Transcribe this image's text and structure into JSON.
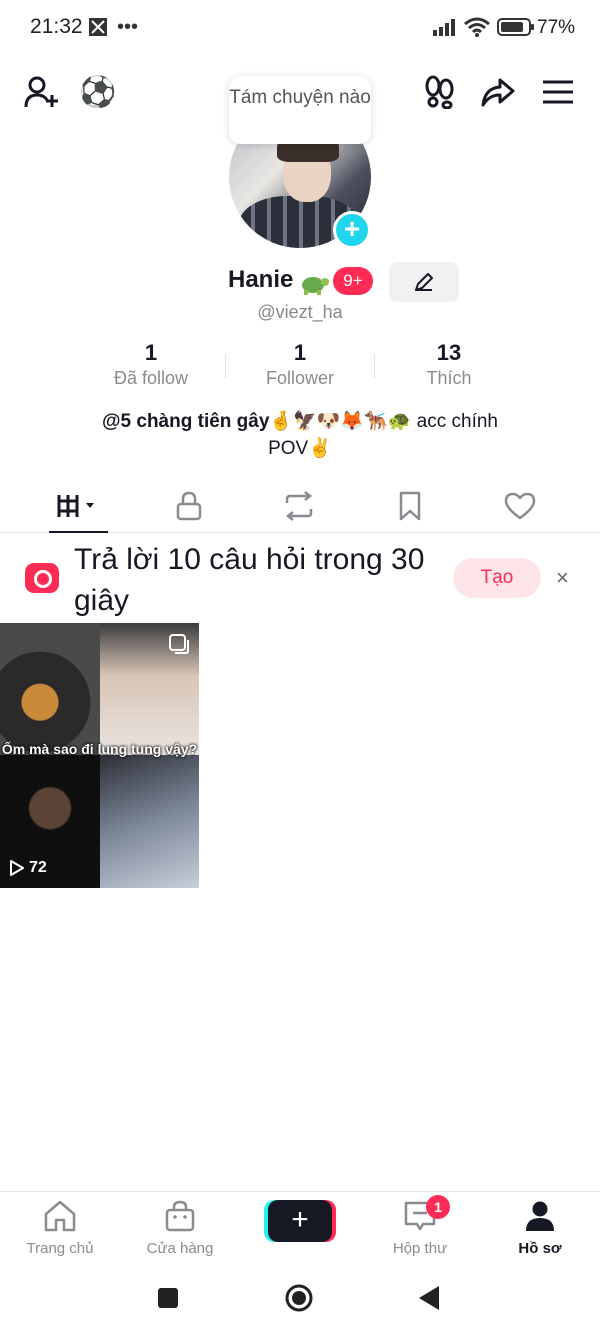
{
  "status_bar": {
    "time": "21:32",
    "battery": "77%"
  },
  "profile": {
    "tooltip": "Tám chuyện nào",
    "name": "Hanie",
    "notification_badge": "9+",
    "handle": "@viezt_ha"
  },
  "stats": [
    {
      "value": "1",
      "label": "Đã follow"
    },
    {
      "value": "1",
      "label": "Follower"
    },
    {
      "value": "13",
      "label": "Thích"
    }
  ],
  "bio": {
    "line1_bold": "@5 chàng tiên gây",
    "line1_emojis": "🤞🦅🐶🦊🐕‍🦺🐢",
    "line1_rest": " acc chính",
    "line2": "POV✌️"
  },
  "banner": {
    "title": "Trả lời 10 câu hỏi trong 30 giây",
    "create": "Tạo",
    "close": "×"
  },
  "video": {
    "caption": "Ốm mà sao đi lung tung vậy?",
    "views": "72"
  },
  "bottom_nav": {
    "home": "Trang chủ",
    "shop": "Cửa hàng",
    "create": "+",
    "inbox": "Hộp thư",
    "inbox_badge": "1",
    "profile": "Hồ sơ"
  }
}
